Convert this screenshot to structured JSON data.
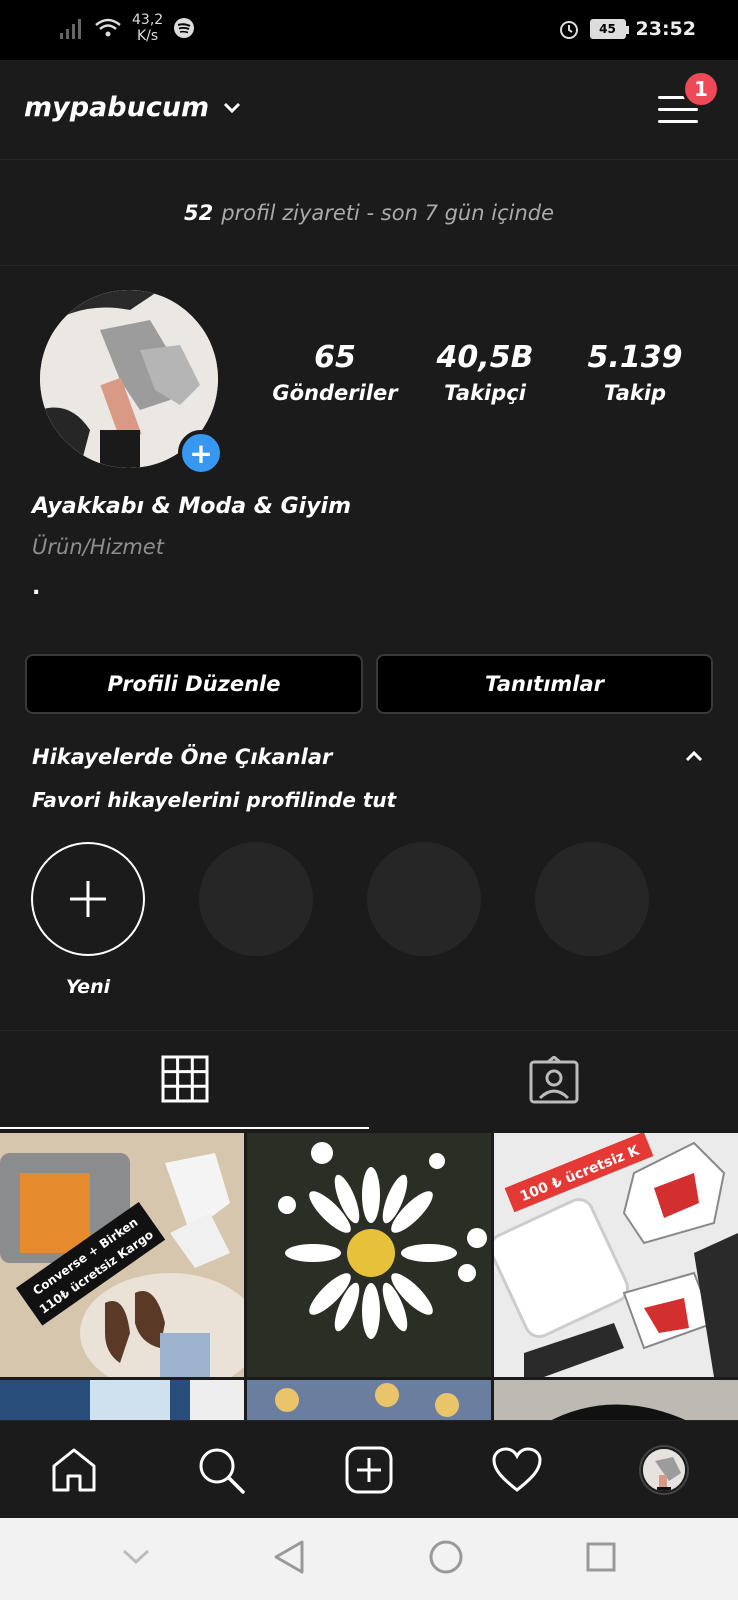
{
  "status_bar": {
    "net_speed_value": "43,2",
    "net_speed_unit": "K/s",
    "battery": "45",
    "time": "23:52"
  },
  "header": {
    "username": "mypabucum",
    "notification_count": "1"
  },
  "insights": {
    "visits_count": "52",
    "visits_text": "profil ziyareti - son 7 gün içinde"
  },
  "profile": {
    "stats": [
      {
        "value": "65",
        "label": "Gönderiler"
      },
      {
        "value": "40,5B",
        "label": "Takipçi"
      },
      {
        "value": "5.139",
        "label": "Takip"
      }
    ],
    "name": "Ayakkabı & Moda & Giyim",
    "category": "Ürün/Hizmet",
    "bio": ".",
    "edit_button": "Profili Düzenle",
    "promotions_button": "Tanıtımlar"
  },
  "highlights": {
    "title": "Hikayelerde Öne Çıkanlar",
    "subtitle": "Favori hikayelerini profilinde tut",
    "new_label": "Yeni"
  },
  "posts": [
    {
      "overlay_text_1": "Converse + Birken",
      "overlay_text_2": "110₺ ücretsiz Kargo"
    },
    {
      "overlay_text_1": ""
    },
    {
      "overlay_text_1": "100 ₺ ücretsiz K"
    }
  ],
  "colors": {
    "background": "#1b1b1b",
    "accent_blue": "#3897f0",
    "badge_red": "#ed4956"
  }
}
